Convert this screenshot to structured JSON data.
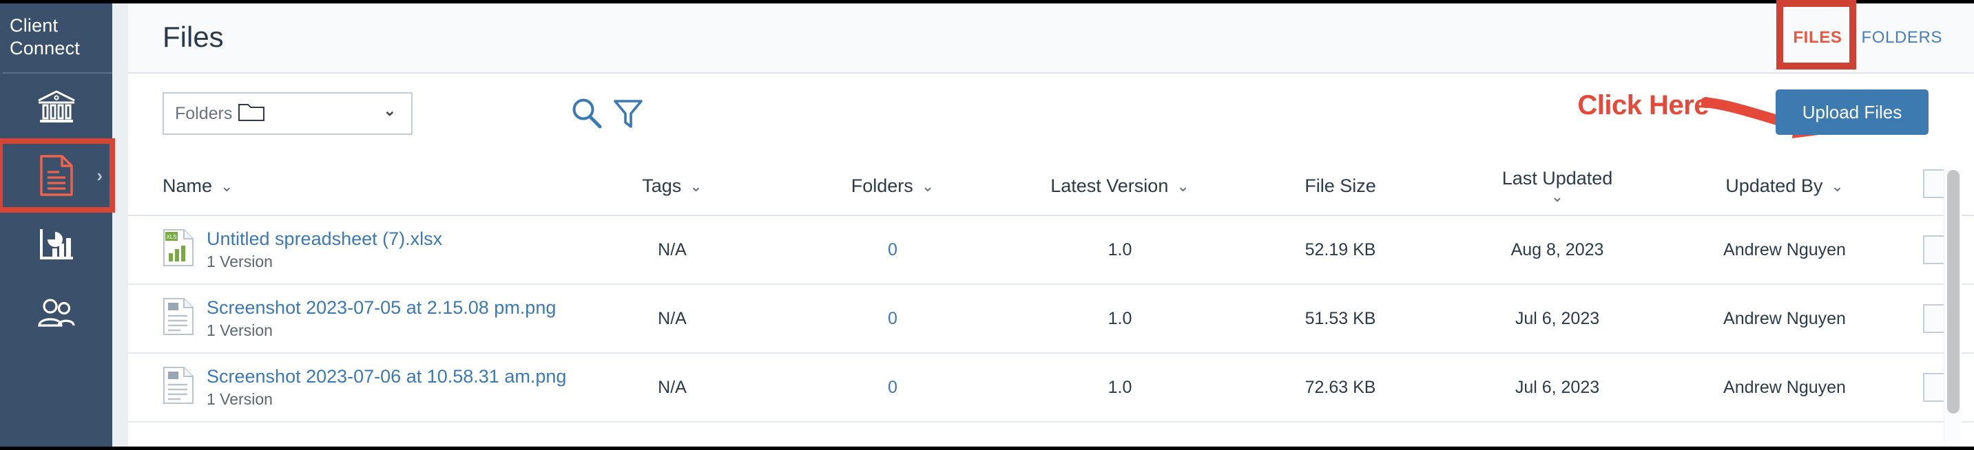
{
  "sidebar": {
    "brand": "Client Connect",
    "items": [
      {
        "id": "institution",
        "icon": "bank-icon",
        "active": false
      },
      {
        "id": "files",
        "icon": "document-icon",
        "active": true,
        "chevron": "›"
      },
      {
        "id": "reports",
        "icon": "chart-icon",
        "active": false
      },
      {
        "id": "contacts",
        "icon": "people-icon",
        "active": false
      }
    ]
  },
  "header": {
    "title": "Files",
    "tabs": [
      {
        "label": "FILES",
        "active": true
      },
      {
        "label": "FOLDERS",
        "active": false
      }
    ]
  },
  "toolbar": {
    "select_value": "Folders",
    "select_icon": "folder-icon",
    "caret": "⌄",
    "search_icon": "search-icon",
    "filter_icon": "filter-icon",
    "upload_label": "Upload Files"
  },
  "annotations": {
    "click_here": "Click Here",
    "box_color": "#cf4233",
    "arrow_color": "#e5493a",
    "text_color": "#e5493a"
  },
  "table": {
    "columns": [
      {
        "key": "name",
        "label": "Name",
        "caret": "⌄",
        "stacked": false
      },
      {
        "key": "tags",
        "label": "Tags",
        "caret": "⌄",
        "stacked": false
      },
      {
        "key": "folders",
        "label": "Folders",
        "caret": "⌄",
        "stacked": false
      },
      {
        "key": "version",
        "label": "Latest Version",
        "caret": "⌄",
        "stacked": false
      },
      {
        "key": "size",
        "label": "File Size",
        "caret": "",
        "stacked": false
      },
      {
        "key": "updated",
        "label": "Last Updated",
        "caret": "⌄",
        "stacked": true
      },
      {
        "key": "by",
        "label": "Updated By",
        "caret": "⌄",
        "stacked": false
      }
    ],
    "rows": [
      {
        "icon": "xls-file-icon",
        "name": "Untitled spreadsheet (7).xlsx",
        "versions": "1 Version",
        "tags": "N/A",
        "folders": "0",
        "version": "1.0",
        "size": "52.19 KB",
        "updated": "Aug 8, 2023",
        "by": "Andrew Nguyen"
      },
      {
        "icon": "generic-file-icon",
        "name": "Screenshot 2023-07-05 at 2.15.08 pm.png",
        "versions": "1 Version",
        "tags": "N/A",
        "folders": "0",
        "version": "1.0",
        "size": "51.53 KB",
        "updated": "Jul 6, 2023",
        "by": "Andrew Nguyen"
      },
      {
        "icon": "generic-file-icon",
        "name": "Screenshot 2023-07-06 at 10.58.31 am.png",
        "versions": "1 Version",
        "tags": "N/A",
        "folders": "0",
        "version": "1.0",
        "size": "72.63 KB",
        "updated": "Jul 6, 2023",
        "by": "Andrew Nguyen"
      }
    ]
  },
  "colors": {
    "sidebar_bg": "#3a506b",
    "accent_orange": "#e8573f",
    "link_blue": "#3b79b5",
    "button_blue": "#3d7ab0",
    "annotation_red": "#cf4233"
  }
}
